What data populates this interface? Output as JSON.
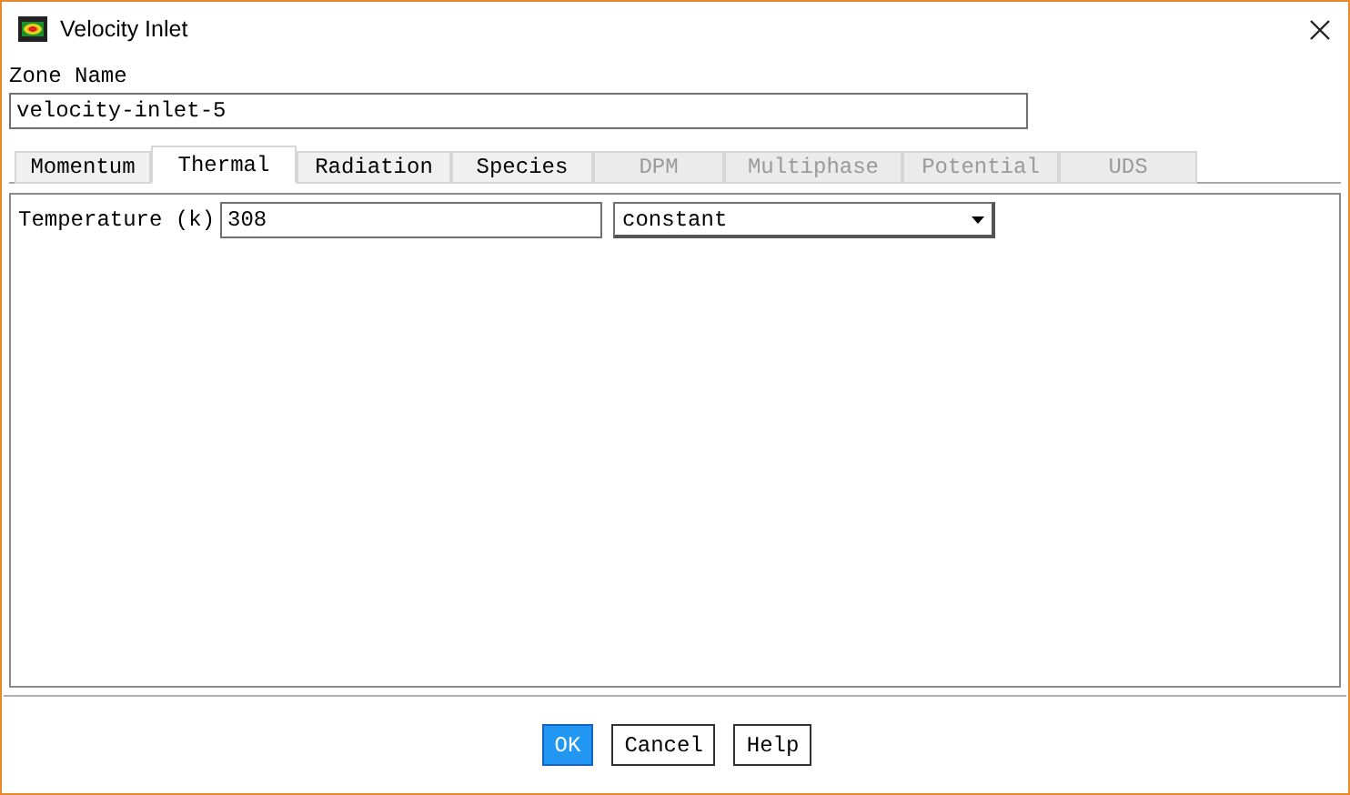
{
  "window": {
    "title": "Velocity Inlet"
  },
  "zone_name": {
    "label": "Zone Name",
    "value": "velocity-inlet-5"
  },
  "tabs": [
    {
      "label": "Momentum",
      "selected": false,
      "disabled": false
    },
    {
      "label": "Thermal",
      "selected": true,
      "disabled": false
    },
    {
      "label": "Radiation",
      "selected": false,
      "disabled": false
    },
    {
      "label": "Species",
      "selected": false,
      "disabled": false
    },
    {
      "label": "DPM",
      "selected": false,
      "disabled": true
    },
    {
      "label": "Multiphase",
      "selected": false,
      "disabled": true
    },
    {
      "label": "Potential",
      "selected": false,
      "disabled": true
    },
    {
      "label": "UDS",
      "selected": false,
      "disabled": true
    }
  ],
  "temperature": {
    "label": "Temperature (k)",
    "value": "308",
    "method": "constant"
  },
  "buttons": [
    {
      "label": "OK",
      "selected": true
    },
    {
      "label": "Cancel",
      "selected": false
    },
    {
      "label": "Help",
      "selected": false
    }
  ]
}
